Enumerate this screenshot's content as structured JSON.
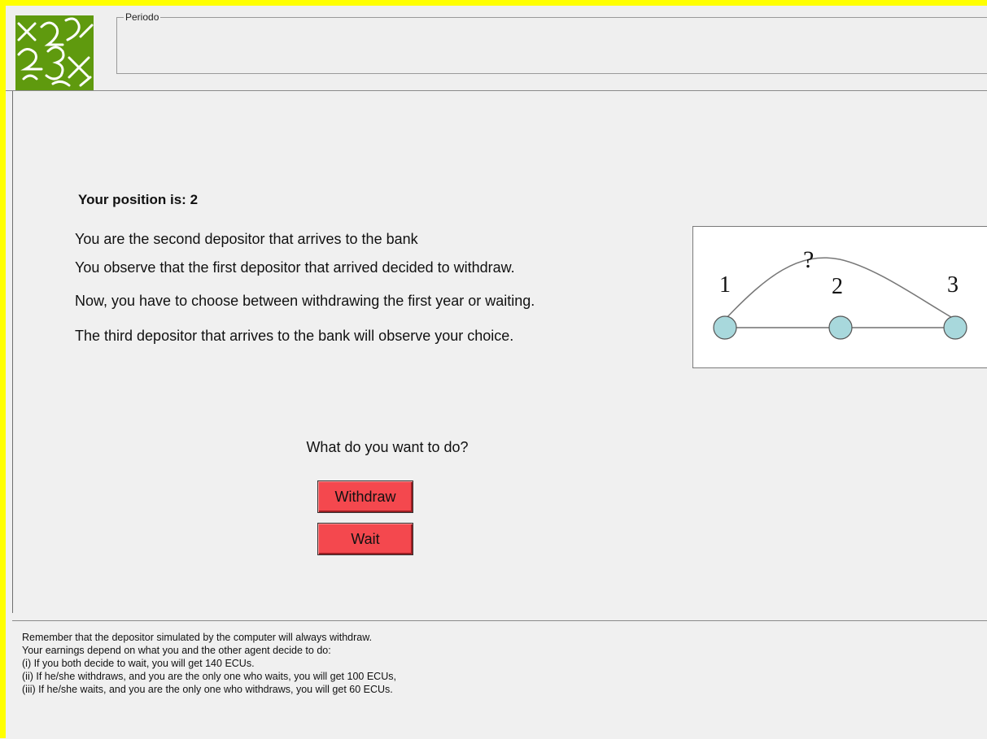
{
  "header": {
    "periodo_label": "Periodo"
  },
  "main": {
    "position_title": "Your position is: 2",
    "lines": [
      "You are the second depositor that arrives to the bank",
      "You observe that the first  depositor that arrived decided to withdraw.",
      "Now, you have to choose between withdrawing the first year or waiting.",
      "The third depositor that arrives to the bank will observe your choice."
    ],
    "diagram": {
      "node_labels": [
        "1",
        "2",
        "3"
      ],
      "question_mark": "?",
      "node_color": "#a8d8dc"
    },
    "question": "What do you want to do?",
    "buttons": {
      "withdraw": "Withdraw",
      "wait": "Wait",
      "color": "#f4484e"
    }
  },
  "footer": {
    "lines": [
      "Remember that the depositor simulated by the computer will always withdraw.",
      "Your earnings depend on what you and the other agent decide to do:",
      "(i) If you both decide to wait, you will get 140 ECUs.",
      "(ii) If he/she withdraws, and you are the only one who waits, you will get 100 ECUs,",
      "(iii) If he/she waits, and you are the only one who withdraws, you will get 60 ECUs."
    ]
  },
  "frame": {
    "accent_color": "#ffff00",
    "logo_color": "#5f9a0e"
  }
}
